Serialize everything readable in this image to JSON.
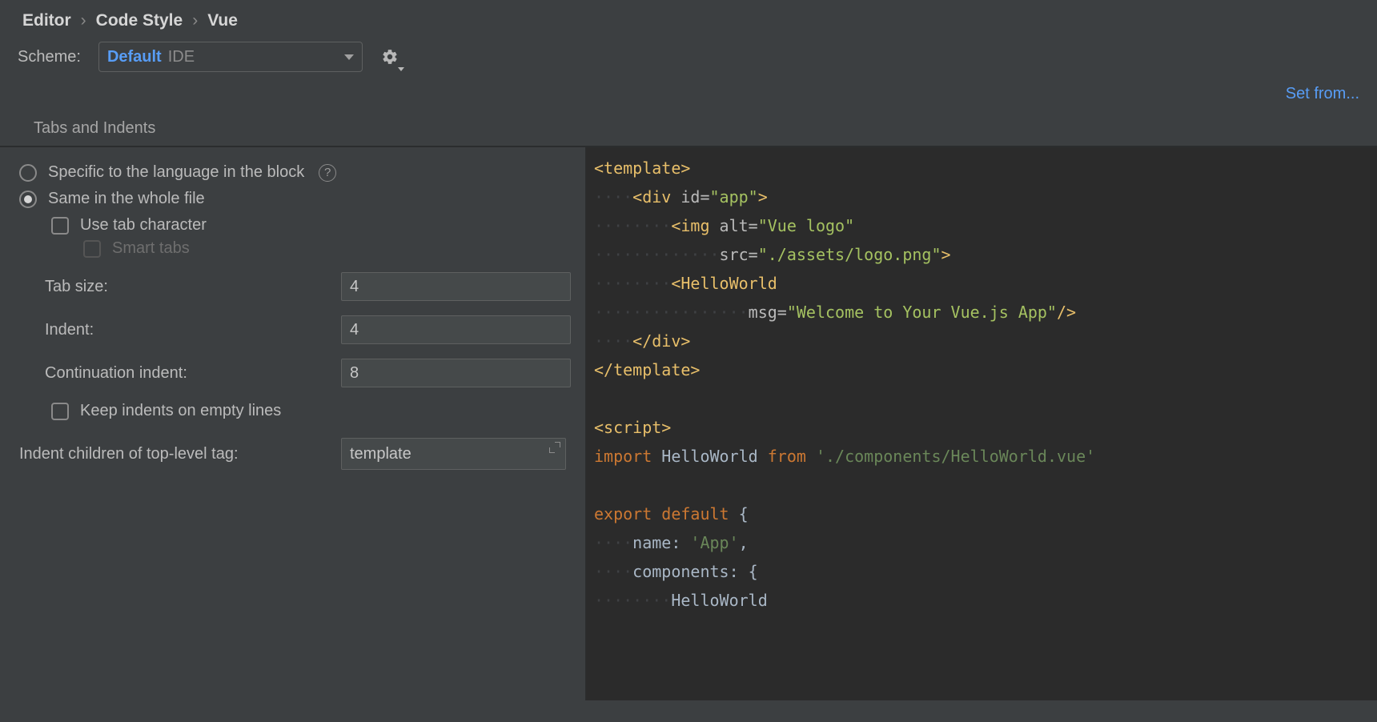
{
  "breadcrumbs": {
    "a": "Editor",
    "b": "Code Style",
    "c": "Vue",
    "sep": "›"
  },
  "scheme": {
    "label": "Scheme:",
    "value": "Default",
    "tag": "IDE"
  },
  "setfrom": "Set from...",
  "tab": {
    "active": "Tabs and Indents"
  },
  "opts": {
    "specific": "Specific to the language in the block",
    "whole": "Same in the whole file",
    "usetab": "Use tab character",
    "smart": "Smart tabs",
    "tabsize_label": "Tab size:",
    "tabsize": "4",
    "indent_label": "Indent:",
    "indent": "4",
    "cont_label": "Continuation indent:",
    "cont": "8",
    "keepempty": "Keep indents on empty lines",
    "toplevel_label": "Indent children of top-level tag:",
    "toplevel_value": "template",
    "help": "?"
  },
  "code": {
    "dot": "·",
    "l1": "<template>",
    "l2_tag": "<div",
    "l2_attr": " id=",
    "l2_val": "\"app\"",
    "l2_end": ">",
    "l3_tag": "<img",
    "l3_attr": " alt=",
    "l3_val": "\"Vue logo\"",
    "l4_attr": "src=",
    "l4_val": "\"./assets/logo.png\"",
    "l4_end": ">",
    "l5_tag": "<HelloWorld",
    "l6_attr": "msg=",
    "l6_val": "\"Welcome to Your Vue.js App\"",
    "l6_end": "/>",
    "l7": "</div>",
    "l8": "</template>",
    "l10": "<script>",
    "l11_a": "import",
    "l11_b": " HelloWorld ",
    "l11_c": "from",
    "l11_d": " ",
    "l11_e": "'./components/HelloWorld.vue'",
    "l13_a": "export ",
    "l13_b": "default ",
    "l13_c": "{",
    "l14_a": "name: ",
    "l14_b": "'App'",
    "l14_c": ",",
    "l15_a": "components: ",
    "l15_b": "{",
    "l16": "HelloWorld"
  }
}
